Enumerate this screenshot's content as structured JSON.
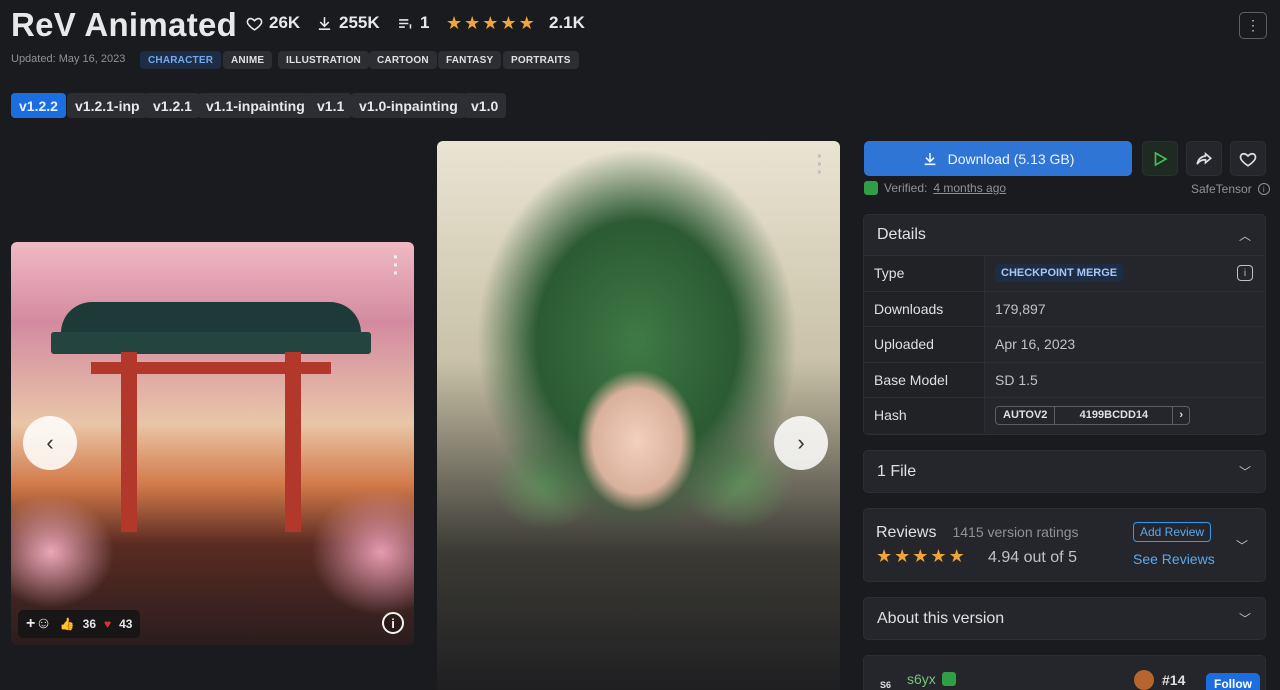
{
  "header": {
    "title": "ReV Animated",
    "likes": "26K",
    "downloads": "255K",
    "versions_count": "1",
    "rating_count": "2.1K",
    "updated": "Updated: May 16, 2023",
    "tags": [
      "CHARACTER",
      "ANIME",
      "ILLUSTRATION",
      "CARTOON",
      "FANTASY",
      "PORTRAITS"
    ]
  },
  "versions": [
    "v1.2.2",
    "v1.2.1-inp",
    "v1.2.1",
    "v1.1-inpainting",
    "v1.1",
    "v1.0-inpainting",
    "v1.0"
  ],
  "gallery": {
    "reactions": {
      "likes": "36",
      "hearts": "43"
    }
  },
  "sidebar": {
    "download_label": "Download (5.13 GB)",
    "verified_prefix": "Verified:",
    "verified_when": "4 months ago",
    "safetensor": "SafeTensor",
    "details": {
      "title": "Details",
      "rows": [
        {
          "key": "Type",
          "value": "CHECKPOINT MERGE"
        },
        {
          "key": "Downloads",
          "value": "179,897"
        },
        {
          "key": "Uploaded",
          "value": "Apr 16, 2023"
        },
        {
          "key": "Base Model",
          "value": "SD 1.5"
        },
        {
          "key": "Hash",
          "value": ""
        }
      ],
      "hash_type": "AUTOV2",
      "hash_value": "4199BCDD14"
    },
    "files": "1 File",
    "reviews": {
      "title": "Reviews",
      "count": "1415 version ratings",
      "score": "4.94 out of 5",
      "add": "Add Review",
      "see": "See Reviews"
    },
    "about": "About this version",
    "creator": {
      "initials": "S6",
      "name": "s6yx",
      "rank": "#14",
      "follow": "Follow"
    }
  },
  "colors": {
    "accent": "#2f75d6",
    "star": "#f0a53a",
    "verified": "#2f9e44"
  }
}
